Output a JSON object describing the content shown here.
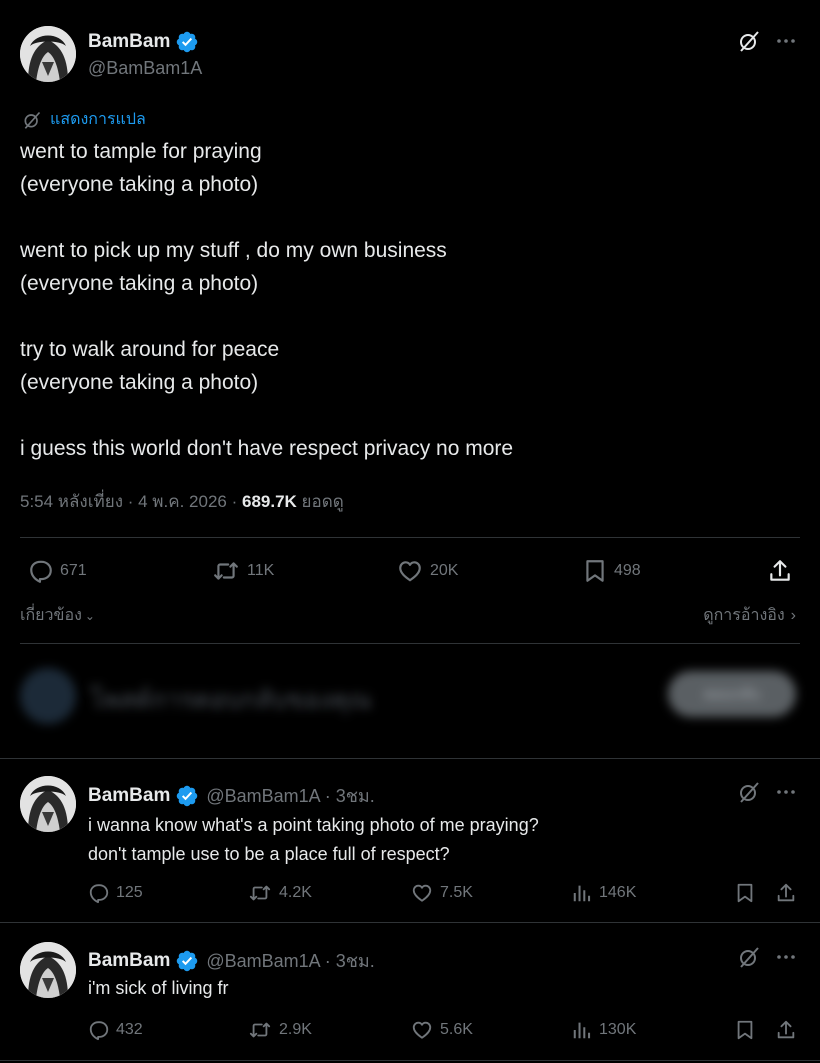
{
  "main_post": {
    "display_name": "BamBam",
    "handle": "@BamBam1A",
    "translate_label": "แสดงการแปล",
    "lines": [
      "went to tample for praying",
      "(everyone taking a photo)",
      "went to pick up my stuff , do my own business",
      "(everyone taking a photo)",
      "try to walk around for peace",
      "(everyone taking a photo)",
      "i guess this world don't have respect privacy no more"
    ],
    "timestamp": "5:54 หลังเที่ยง · 4 พ.ค. 2026 · ",
    "views_value": "689.7K",
    "views_label": " ยอดดู",
    "stats": {
      "replies": "671",
      "reposts": "11K",
      "likes": "20K",
      "bookmarks": "498"
    },
    "related_label": "เกี่ยวข้อง",
    "quotes_label": "ดูการอ้างอิง"
  },
  "reply_box": {
    "placeholder": "โพสต์การตอบกลับของคุณ",
    "button_label": "ตอบกลับ"
  },
  "replies": [
    {
      "display_name": "BamBam",
      "handle_time": "@BamBam1A · 3ชม.",
      "lines": [
        "i wanna know what's a point taking photo of me praying?",
        "don't tample use to be a place full of respect?"
      ],
      "stats": {
        "replies": "125",
        "reposts": "4.2K",
        "likes": "7.5K",
        "views": "146K"
      }
    },
    {
      "display_name": "BamBam",
      "handle_time": "@BamBam1A · 3ชม.",
      "lines": [
        "i'm sick of living fr"
      ],
      "stats": {
        "replies": "432",
        "reposts": "2.9K",
        "likes": "5.6K",
        "views": "130K"
      }
    }
  ],
  "colors": {
    "background": "#000000",
    "text": "#e7e9ea",
    "muted": "#71767b",
    "accent": "#1d9bf0",
    "divider": "#2f3336"
  },
  "icons": {
    "verified": "verified-badge-icon",
    "grok": "grok-icon",
    "more": "more-icon",
    "reply": "reply-icon",
    "repost": "repost-icon",
    "like": "like-icon",
    "bookmark": "bookmark-icon",
    "share": "share-icon",
    "views": "views-icon"
  }
}
